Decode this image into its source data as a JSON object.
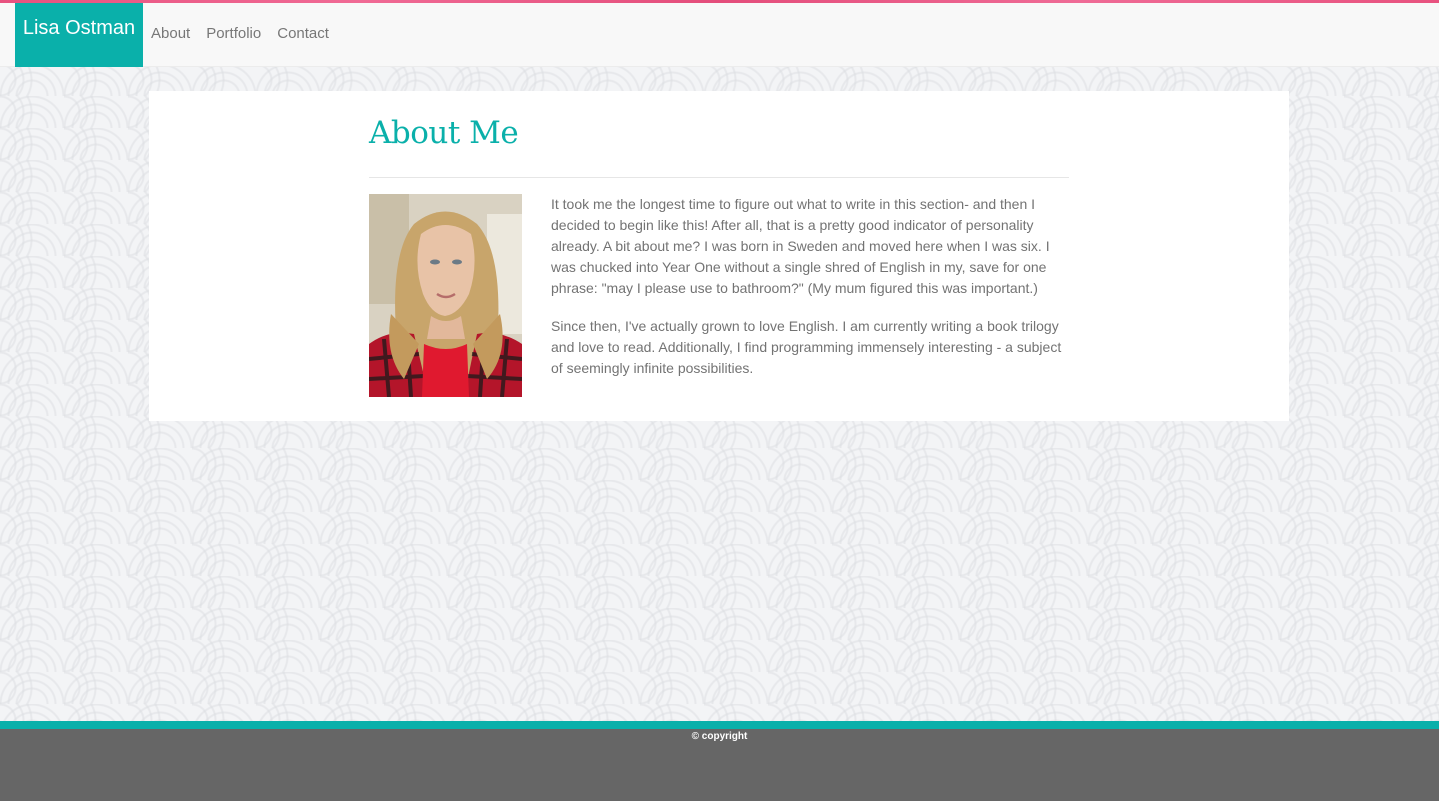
{
  "nav": {
    "brand": "Lisa Ostman",
    "links": [
      "About",
      "Portfolio",
      "Contact"
    ]
  },
  "about": {
    "title": "About Me",
    "paragraphs": [
      "It took me the longest time to figure out what to write in this section- and then I decided to begin like this! After all, that is a pretty good indicator of personality already. A bit about me? I was born in Sweden and moved here when I was six. I was chucked into Year One without a single shred of English in my, save for one phrase: \"may I please use to bathroom?\" (My mum figured this was important.)",
      "Since then, I've actually grown to love English. I am currently writing a book trilogy and love to read. Additionally, I find programming immensely interesting - a subject of seemingly infinite possibilities."
    ]
  },
  "footer": {
    "copyright": "© copyright"
  },
  "colors": {
    "accent": "#0ab0aa",
    "top_stripe": "#e8527f",
    "footer": "#666666"
  }
}
